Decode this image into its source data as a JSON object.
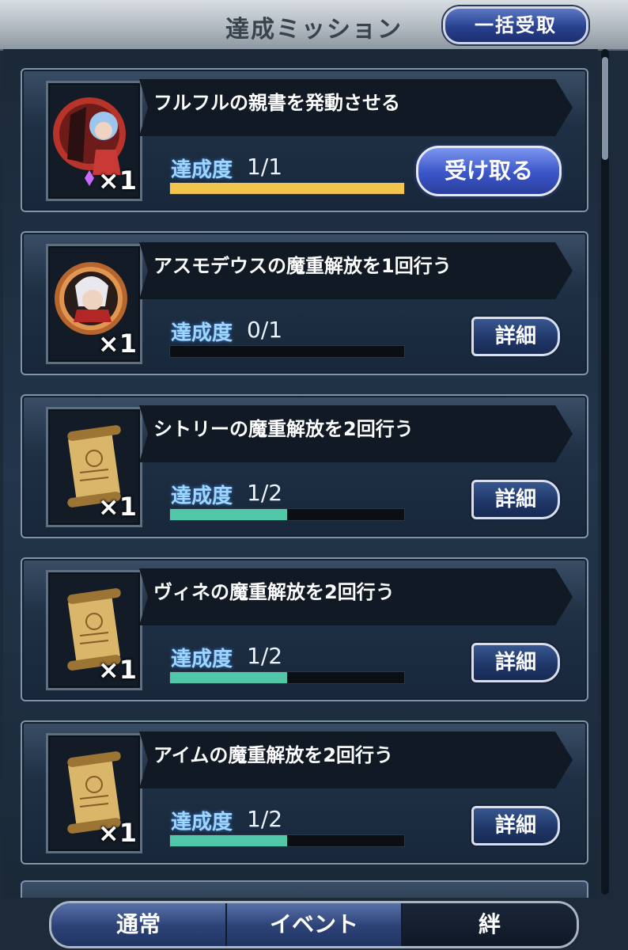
{
  "header": {
    "title": "達成ミッション",
    "bulk_button": "一括受取"
  },
  "missions": [
    {
      "title": "フルフルの親書を発動させる",
      "progress_label": "達成度",
      "progress_text": "1/1",
      "progress_fraction": 1.0,
      "bar_color": "#f2c64c",
      "reward_icon": "character-card-icon",
      "quantity": "×1",
      "action": "受け取る"
    },
    {
      "title": "アスモデウスの魔重解放を1回行う",
      "progress_label": "達成度",
      "progress_text": "0/1",
      "progress_fraction": 0.0,
      "bar_color": "#4fc7a8",
      "reward_icon": "character-medal-icon",
      "quantity": "×1",
      "action": "詳細"
    },
    {
      "title": "シトリーの魔重解放を2回行う",
      "progress_label": "達成度",
      "progress_text": "1/2",
      "progress_fraction": 0.5,
      "bar_color": "#4fc7a8",
      "reward_icon": "scroll-icon",
      "quantity": "×1",
      "action": "詳細"
    },
    {
      "title": "ヴィネの魔重解放を2回行う",
      "progress_label": "達成度",
      "progress_text": "1/2",
      "progress_fraction": 0.5,
      "bar_color": "#4fc7a8",
      "reward_icon": "scroll-icon",
      "quantity": "×1",
      "action": "詳細"
    },
    {
      "title": "アイムの魔重解放を2回行う",
      "progress_label": "達成度",
      "progress_text": "1/2",
      "progress_fraction": 0.5,
      "bar_color": "#4fc7a8",
      "reward_icon": "scroll-icon",
      "quantity": "×1",
      "action": "詳細"
    }
  ],
  "tabs": [
    {
      "label": "通常",
      "active": false
    },
    {
      "label": "イベント",
      "active": false
    },
    {
      "label": "絆",
      "active": true
    }
  ]
}
